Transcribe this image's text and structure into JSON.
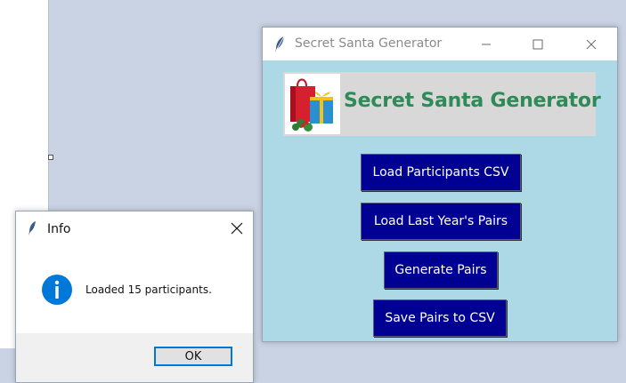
{
  "main_window": {
    "title": "Secret Santa Generator",
    "banner_text": "Secret Santa Generator",
    "buttons": [
      {
        "label": "Load Participants CSV"
      },
      {
        "label": "Load Last Year's Pairs"
      },
      {
        "label": "Generate Pairs"
      },
      {
        "label": "Save Pairs to CSV"
      }
    ]
  },
  "dialog": {
    "title": "Info",
    "message": "Loaded 15 participants.",
    "ok_label": "OK"
  },
  "colors": {
    "window_background": "#add8e6",
    "button_background": "#000092",
    "banner_text": "#2e8b57",
    "info_icon": "#0078d7"
  },
  "icons": [
    "feather-icon",
    "minimize-icon",
    "maximize-icon",
    "close-icon",
    "gift-icon",
    "info-icon"
  ]
}
